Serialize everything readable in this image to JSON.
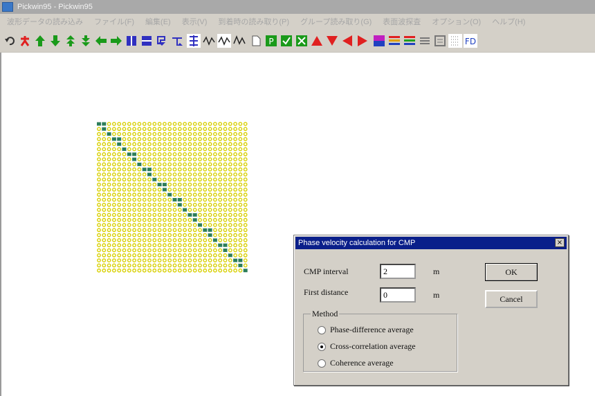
{
  "window": {
    "title": "Pickwin95 - Pickwin95",
    "menu": [
      "波形データの読み込み",
      "ファイル(F)",
      "編集(E)",
      "表示(V)",
      "到着時の読み取り(P)",
      "グループ読み取り(G)",
      "表面波探査",
      "オプション(O)",
      "ヘルプ(H)"
    ]
  },
  "toolbar": {
    "buttons": [
      {
        "icon": "undo-icon",
        "color": "#333333"
      },
      {
        "icon": "figure-red-icon",
        "color": "#e02020"
      },
      {
        "icon": "arrow-up-icon",
        "color": "#1a9a1a"
      },
      {
        "icon": "arrow-down-icon",
        "color": "#1a9a1a"
      },
      {
        "icon": "double-up-icon",
        "color": "#1a9a1a"
      },
      {
        "icon": "double-down-icon",
        "color": "#1a9a1a"
      },
      {
        "icon": "arrow-left-icon",
        "color": "#1a9a1a"
      },
      {
        "icon": "arrow-right-icon",
        "color": "#1a9a1a"
      },
      {
        "icon": "zoom-in-icon",
        "color": "#3030c0"
      },
      {
        "icon": "zoom-out-icon",
        "color": "#3030c0"
      },
      {
        "icon": "text-down-icon",
        "color": "#3030c0"
      },
      {
        "icon": "text-up-icon",
        "color": "#3030c0"
      },
      {
        "icon": "grid-select-icon",
        "color": "#3030c0"
      },
      {
        "icon": "wave1-icon",
        "color": "#222222"
      },
      {
        "icon": "wave2-icon",
        "color": "#222222"
      },
      {
        "icon": "wave3-icon",
        "color": "#222222"
      },
      {
        "icon": "page-icon",
        "color": "#555555"
      },
      {
        "icon": "p-icon",
        "color": "#1a9a1a"
      },
      {
        "icon": "check-icon",
        "color": "#1a9a1a"
      },
      {
        "icon": "cross-icon",
        "color": "#1a9a1a"
      },
      {
        "icon": "triangle-up-icon",
        "color": "#e02020"
      },
      {
        "icon": "triangle-down-icon",
        "color": "#e02020"
      },
      {
        "icon": "triangle-left-icon",
        "color": "#e02020"
      },
      {
        "icon": "triangle-right-icon",
        "color": "#e02020"
      },
      {
        "icon": "gradient-icon",
        "color": "#c020c0"
      },
      {
        "icon": "stripes-icon",
        "color": "#e0a000"
      },
      {
        "icon": "stripes2-icon",
        "color": "#20a020"
      },
      {
        "icon": "gray-lines-icon",
        "color": "#777777"
      },
      {
        "icon": "gray-box-icon",
        "color": "#777777"
      },
      {
        "icon": "dots-icon",
        "color": "#777777"
      },
      {
        "icon": "fd-icon",
        "color": "#2040c0"
      }
    ]
  },
  "matrix": {
    "rows": 30,
    "cols": 30,
    "marker_color": "#d8d000",
    "diagonal_color": "#2c7d5a"
  },
  "dialog": {
    "title": "Phase velocity calculation for CMP",
    "close": "×",
    "cmp_interval_label": "CMP interval",
    "cmp_interval_value": "2",
    "cmp_interval_unit": "m",
    "first_distance_label": "First distance",
    "first_distance_value": "0",
    "first_distance_unit": "m",
    "ok_label": "OK",
    "cancel_label": "Cancel",
    "method_label": "Method",
    "methods": [
      {
        "label": "Phase-difference average",
        "selected": false
      },
      {
        "label": "Cross-correlation average",
        "selected": true
      },
      {
        "label": "Coherence average",
        "selected": false
      }
    ]
  }
}
